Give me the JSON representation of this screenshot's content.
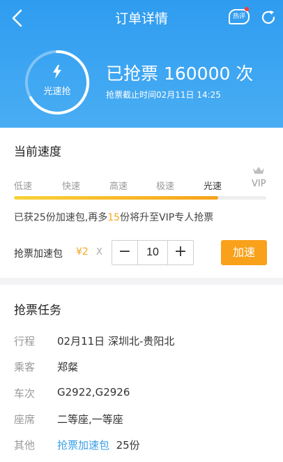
{
  "header": {
    "title": "订单详情",
    "hot_label": "热评",
    "status": {
      "ring_label": "光速抢",
      "main_text": "已抢票 160000 次",
      "deadline": "抢票截止时间02月11日 14:25"
    }
  },
  "speed": {
    "section_title": "当前速度",
    "levels": [
      "低速",
      "快速",
      "高速",
      "极速",
      "光速",
      "VIP"
    ],
    "current_level": "光速",
    "progress_fraction": 0.81,
    "info_prefix": "已获25份加速包,再多",
    "info_highlight": "15",
    "info_suffix": "份将升至VIP专人抢票",
    "package_label": "抢票加速包",
    "package_price": "¥2",
    "multiply": "X",
    "quantity": "10",
    "minus": "−",
    "plus": "+",
    "boost_button": "加速"
  },
  "task": {
    "section_title": "抢票任务",
    "rows": [
      {
        "key": "行程",
        "value": "02月11日  深圳北-贵阳北"
      },
      {
        "key": "乘客",
        "value": "郑粲"
      },
      {
        "key": "车次",
        "value": "G2922,G2926"
      },
      {
        "key": "座席",
        "value": "二等座,一等座"
      },
      {
        "key": "其他",
        "link": "抢票加速包",
        "value": "25份"
      }
    ]
  },
  "colors": {
    "header_blue": "#3aa3f2",
    "accent_orange": "#f9a11b",
    "link_blue": "#3aa0e8"
  }
}
